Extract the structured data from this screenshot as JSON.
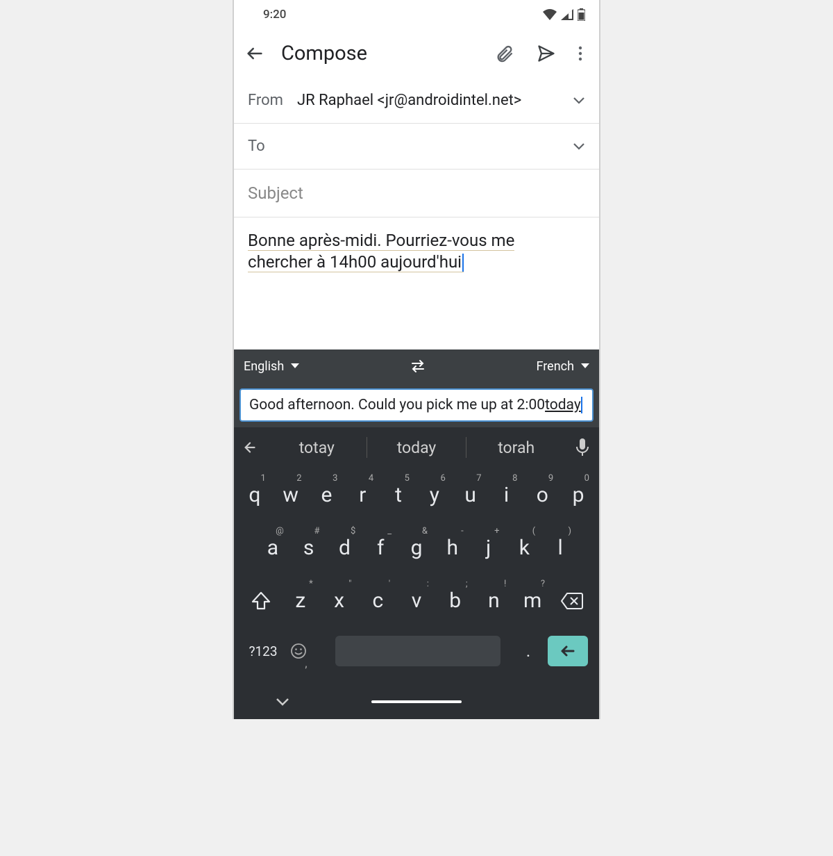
{
  "status": {
    "time": "9:20"
  },
  "app": {
    "title": "Compose"
  },
  "fields": {
    "from_label": "From",
    "from_value": "JR Raphael  <jr@androidintel.net>",
    "to_label": "To",
    "subject_placeholder": "Subject"
  },
  "body": {
    "line1": "Bonne après-midi. Pourriez-vous me",
    "line2": "chercher à 14h00 aujourd'hui"
  },
  "translate": {
    "source_lang": "English",
    "target_lang": "French",
    "input_prefix": "Good afternoon. Could you pick me up at 2:00 ",
    "input_underlined": "today"
  },
  "suggestions": [
    "totay",
    "today",
    "torah"
  ],
  "keyboard": {
    "row1": [
      {
        "k": "q",
        "h": "1"
      },
      {
        "k": "w",
        "h": "2"
      },
      {
        "k": "e",
        "h": "3"
      },
      {
        "k": "r",
        "h": "4"
      },
      {
        "k": "t",
        "h": "5"
      },
      {
        "k": "y",
        "h": "6"
      },
      {
        "k": "u",
        "h": "7"
      },
      {
        "k": "i",
        "h": "8"
      },
      {
        "k": "o",
        "h": "9"
      },
      {
        "k": "p",
        "h": "0"
      }
    ],
    "row2": [
      {
        "k": "a",
        "h": "@"
      },
      {
        "k": "s",
        "h": "#"
      },
      {
        "k": "d",
        "h": "$"
      },
      {
        "k": "f",
        "h": "_"
      },
      {
        "k": "g",
        "h": "&"
      },
      {
        "k": "h",
        "h": "-"
      },
      {
        "k": "j",
        "h": "+"
      },
      {
        "k": "k",
        "h": "("
      },
      {
        "k": "l",
        "h": ")"
      }
    ],
    "row3": [
      {
        "k": "z",
        "h": "*"
      },
      {
        "k": "x",
        "h": "\""
      },
      {
        "k": "c",
        "h": "'"
      },
      {
        "k": "v",
        "h": ":"
      },
      {
        "k": "b",
        "h": ";"
      },
      {
        "k": "n",
        "h": "!"
      },
      {
        "k": "m",
        "h": "?"
      }
    ],
    "sym": "?123",
    "period": "."
  }
}
